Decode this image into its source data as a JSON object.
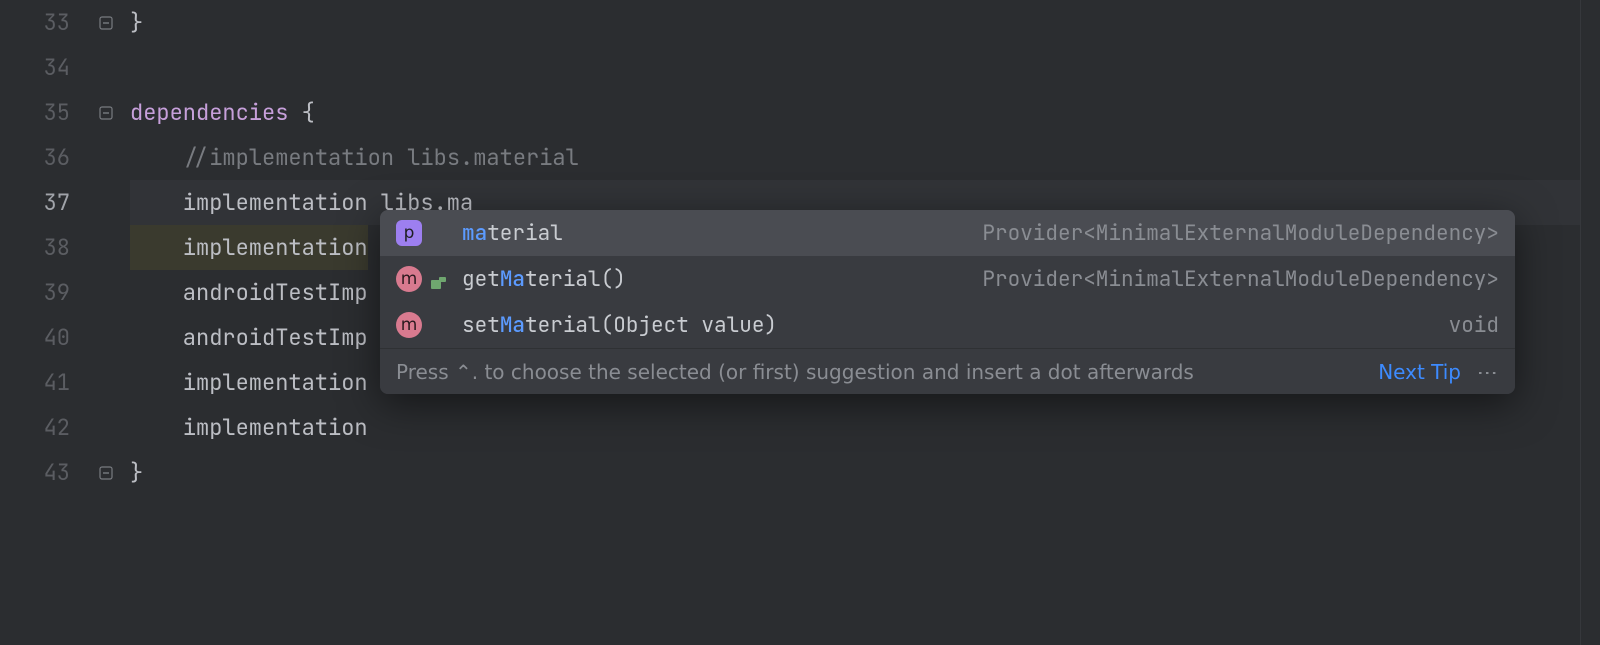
{
  "lines": [
    {
      "num": "33",
      "fold": "close",
      "segments": [
        {
          "cls": "punct",
          "t": "}"
        }
      ]
    },
    {
      "num": "34",
      "segments": []
    },
    {
      "num": "35",
      "fold": "open",
      "segments": [
        {
          "cls": "kw",
          "t": "dependencies"
        },
        {
          "cls": "txt",
          "t": " "
        },
        {
          "cls": "punct",
          "t": "{"
        }
      ]
    },
    {
      "num": "36",
      "segments": [
        {
          "cls": "txt",
          "t": "    "
        },
        {
          "cls": "comment",
          "t": "//implementation libs.material"
        }
      ]
    },
    {
      "num": "37",
      "current": true,
      "segments": [
        {
          "cls": "txt",
          "t": "    implementation libs.ma"
        }
      ]
    },
    {
      "num": "38",
      "hl": true,
      "segments": [
        {
          "cls": "txt",
          "t": "    implementation"
        }
      ]
    },
    {
      "num": "39",
      "segments": [
        {
          "cls": "txt",
          "t": "    androidTestImp"
        }
      ]
    },
    {
      "num": "40",
      "segments": [
        {
          "cls": "txt",
          "t": "    androidTestImp"
        }
      ]
    },
    {
      "num": "41",
      "segments": [
        {
          "cls": "txt",
          "t": "    implementation"
        }
      ]
    },
    {
      "num": "42",
      "segments": [
        {
          "cls": "txt",
          "t": "    implementation"
        }
      ]
    },
    {
      "num": "43",
      "fold": "close",
      "segments": [
        {
          "cls": "punct",
          "t": "}"
        }
      ]
    }
  ],
  "popup": {
    "items": [
      {
        "badge": "p",
        "badgeCls": "p",
        "subIcon": false,
        "prefix": "ma",
        "rest": "terial",
        "suffix": "",
        "right": "Provider<MinimalExternalModuleDependency>",
        "selected": true
      },
      {
        "badge": "m",
        "badgeCls": "m",
        "subIcon": true,
        "prefix": "get",
        "match": "Ma",
        "rest": "terial",
        "suffix": "()",
        "right": "Provider<MinimalExternalModuleDependency>"
      },
      {
        "badge": "m",
        "badgeCls": "m",
        "subIcon": false,
        "prefix": "set",
        "match": "Ma",
        "rest": "terial",
        "suffix": "(Object value)",
        "right": "void"
      }
    ],
    "hint": "Press ⌃. to choose the selected (or first) suggestion and insert a dot afterwards",
    "link": "Next Tip",
    "more": "⋮"
  }
}
